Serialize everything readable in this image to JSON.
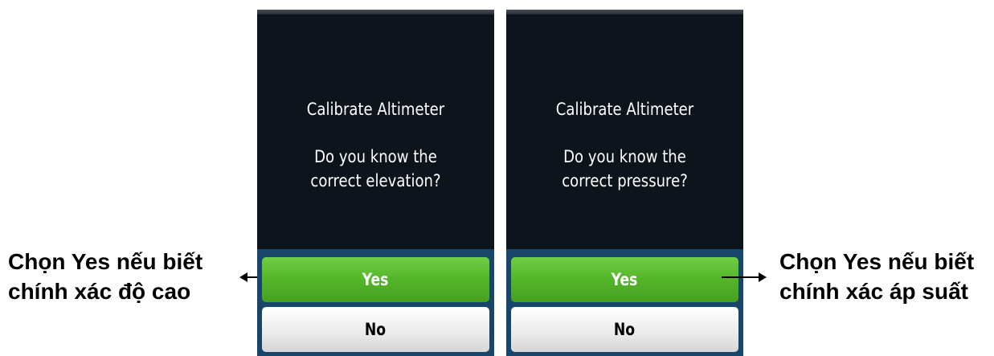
{
  "left_screen": {
    "title": "Calibrate Altimeter",
    "question_line1": "Do you know the",
    "question_line2": "correct elevation?",
    "yes_label": "Yes",
    "no_label": "No"
  },
  "right_screen": {
    "title": "Calibrate Altimeter",
    "question_line1": "Do you know the",
    "question_line2": "correct pressure?",
    "yes_label": "Yes",
    "no_label": "No"
  },
  "left_caption": {
    "line1": "Chọn Yes nếu biết",
    "line2": "chính xác độ cao"
  },
  "right_caption": {
    "line1": "Chọn Yes nếu biết",
    "line2": "chính xác áp suất"
  },
  "colors": {
    "screen_bg": "#0e141b",
    "button_area": "#17466a",
    "yes_button": "#54b52a",
    "no_button": "#ececec"
  }
}
